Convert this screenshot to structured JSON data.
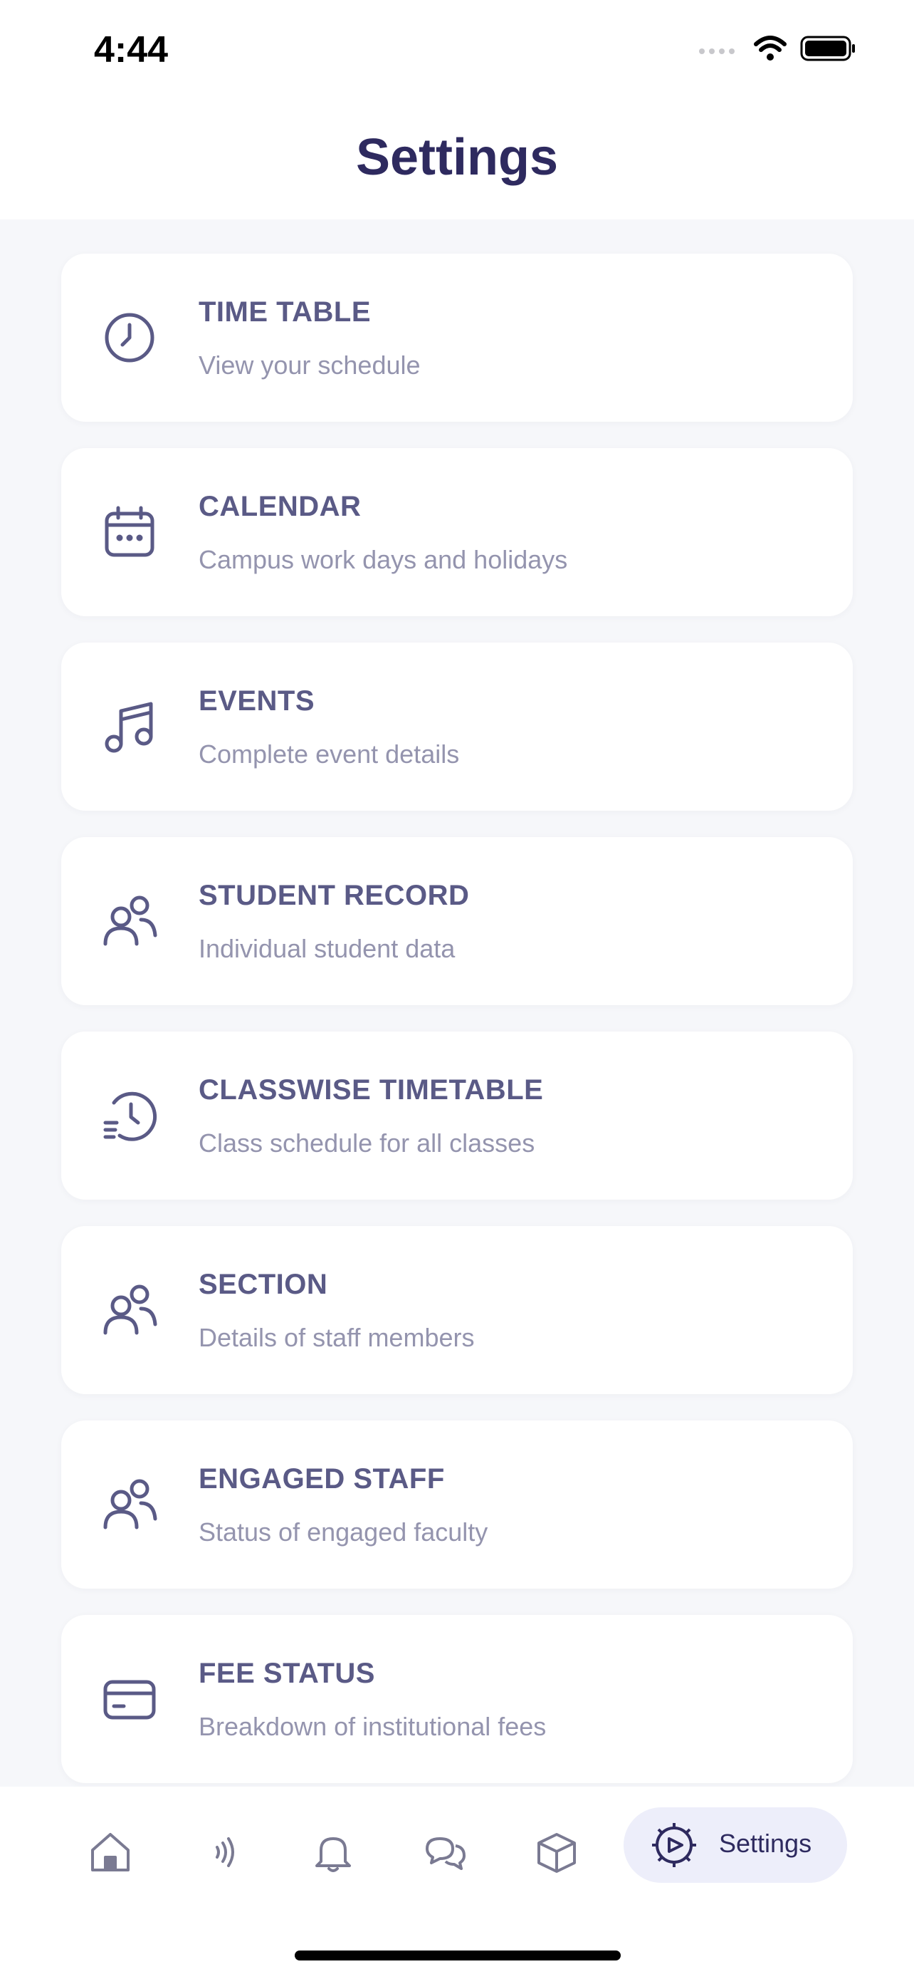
{
  "status_bar": {
    "time": "4:44"
  },
  "header": {
    "title": "Settings"
  },
  "cards": [
    {
      "title": "TIME TABLE",
      "subtitle": "View your schedule",
      "icon": "clock-icon"
    },
    {
      "title": "CALENDAR",
      "subtitle": "Campus work days and holidays",
      "icon": "calendar-icon"
    },
    {
      "title": "EVENTS",
      "subtitle": "Complete event details",
      "icon": "music-note-icon"
    },
    {
      "title": "STUDENT RECORD",
      "subtitle": "Individual student data",
      "icon": "users-icon"
    },
    {
      "title": "CLASSWISE TIMETABLE",
      "subtitle": "Class schedule for all classes",
      "icon": "history-clock-icon"
    },
    {
      "title": "SECTION",
      "subtitle": "Details of staff members",
      "icon": "users-icon"
    },
    {
      "title": "ENGAGED STAFF",
      "subtitle": "Status of engaged faculty",
      "icon": "users-icon"
    },
    {
      "title": "FEE STATUS",
      "subtitle": "Breakdown of institutional fees",
      "icon": "credit-card-icon"
    }
  ],
  "bottom_nav": {
    "items": [
      "home-icon",
      "signal-icon",
      "bell-icon",
      "chat-icon",
      "box-icon"
    ],
    "active_label": "Settings",
    "active_icon": "gear-icon"
  },
  "colors": {
    "title": "#2e2a5f",
    "card_title": "#5a5a86",
    "card_subtitle": "#9494ae",
    "icon": "#5a5a86",
    "background": "#f6f7fa",
    "active_pill": "#edeefa"
  }
}
